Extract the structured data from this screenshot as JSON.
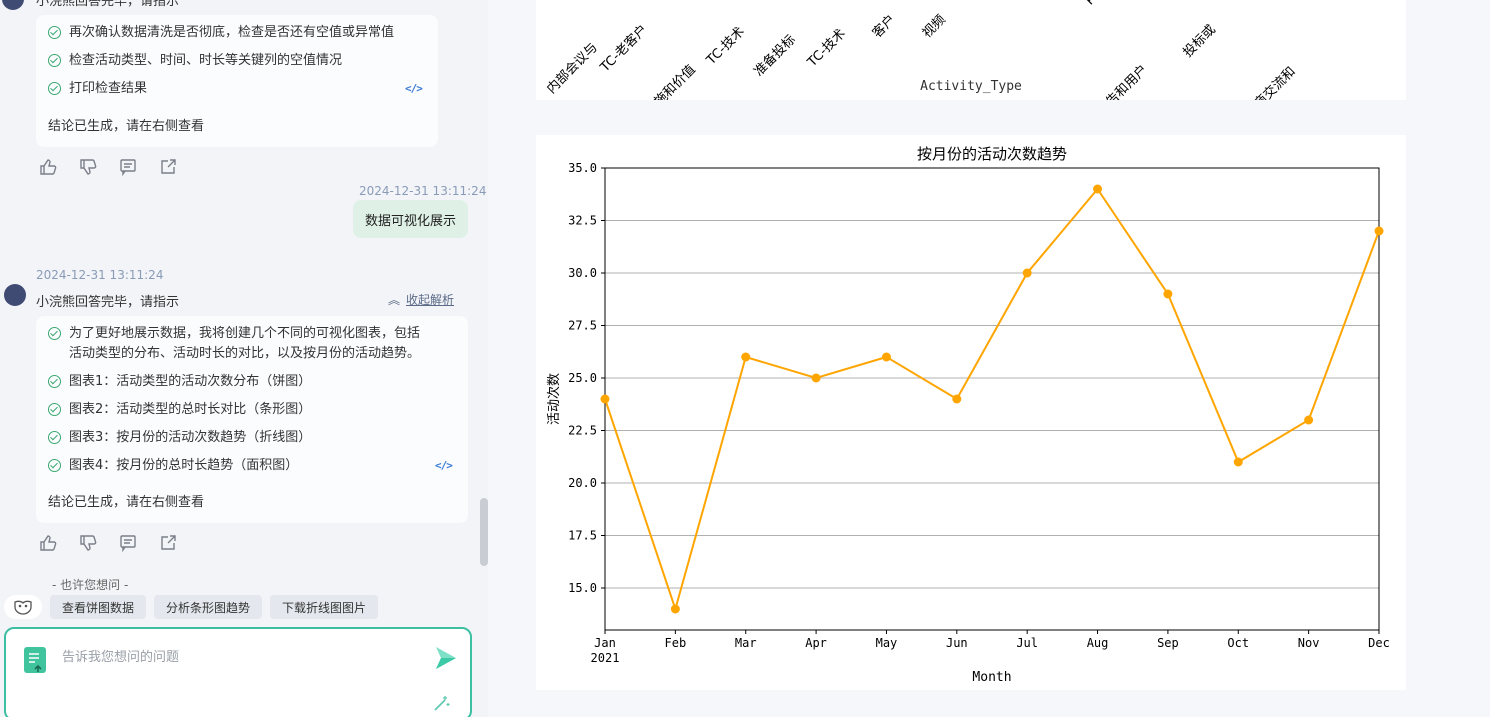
{
  "chat": {
    "top_partial_header": "小浣熊回答完毕，请指示",
    "card1": {
      "steps": [
        "再次确认数据清洗是否彻底，检查是否还有空值或异常值",
        "检查活动类型、时间、时长等关键列的空值情况",
        "打印检查结果"
      ],
      "conclusion": "结论已生成，请在右侧查看"
    },
    "user_msg": {
      "timestamp": "2024-12-31 13:11:24",
      "text": "数据可视化展示"
    },
    "bot_msg": {
      "timestamp": "2024-12-31 13:11:24",
      "name": "小浣熊回答完毕，请指示",
      "collapse_label": "收起解析",
      "steps": [
        "为了更好地展示数据，我将创建几个不同的可视化图表，包括",
        "活动类型的分布、活动时长的对比，以及按月份的活动趋势。",
        "图表1：活动类型的活动次数分布（饼图）",
        "图表2：活动类型的总时长对比（条形图）",
        "图表3：按月份的活动次数趋势（折线图）",
        "图表4：按月份的总时长趋势（面积图）"
      ],
      "conclusion": "结论已生成，请在右侧查看"
    },
    "suggest_title": "- 也许您想问 -",
    "suggestions": [
      "查看饼图数据",
      "分析条形图趋势",
      "下载折线图图片"
    ],
    "input_placeholder": "告诉我您想问的问题",
    "icons": [
      "thumbs-up-icon",
      "thumbs-down-icon",
      "comment-icon",
      "share-icon",
      "check-circle-icon",
      "code-icon",
      "mask-icon",
      "document-upload-icon",
      "send-icon",
      "magic-wand-icon"
    ]
  },
  "top_chart": {
    "xlabel": "Activity_Type",
    "tick_labels": [
      "内部会议与",
      "TC-老客户",
      "POC-实施和价值",
      "TC-技术",
      "准备投标",
      "TC-技术",
      "客户",
      "视频",
      "P",
      "POC-报告和用户",
      "投标或",
      "TC-代理商交流和"
    ]
  },
  "chart_data": {
    "type": "line",
    "title": "按月份的活动次数趋势",
    "xlabel": "Month",
    "ylabel": "活动次数",
    "categories": [
      "Jan",
      "Feb",
      "Mar",
      "Apr",
      "May",
      "Jun",
      "Jul",
      "Aug",
      "Sep",
      "Oct",
      "Nov",
      "Dec"
    ],
    "year_label": "2021",
    "values": [
      24,
      14,
      26,
      25,
      26,
      24,
      30,
      34,
      29,
      21,
      23,
      32
    ],
    "yticks": [
      "15.0",
      "17.5",
      "20.0",
      "22.5",
      "25.0",
      "27.5",
      "30.0",
      "32.5",
      "35.0"
    ],
    "ylim": [
      13,
      35
    ],
    "grid": "y",
    "color": "#ffa500"
  }
}
